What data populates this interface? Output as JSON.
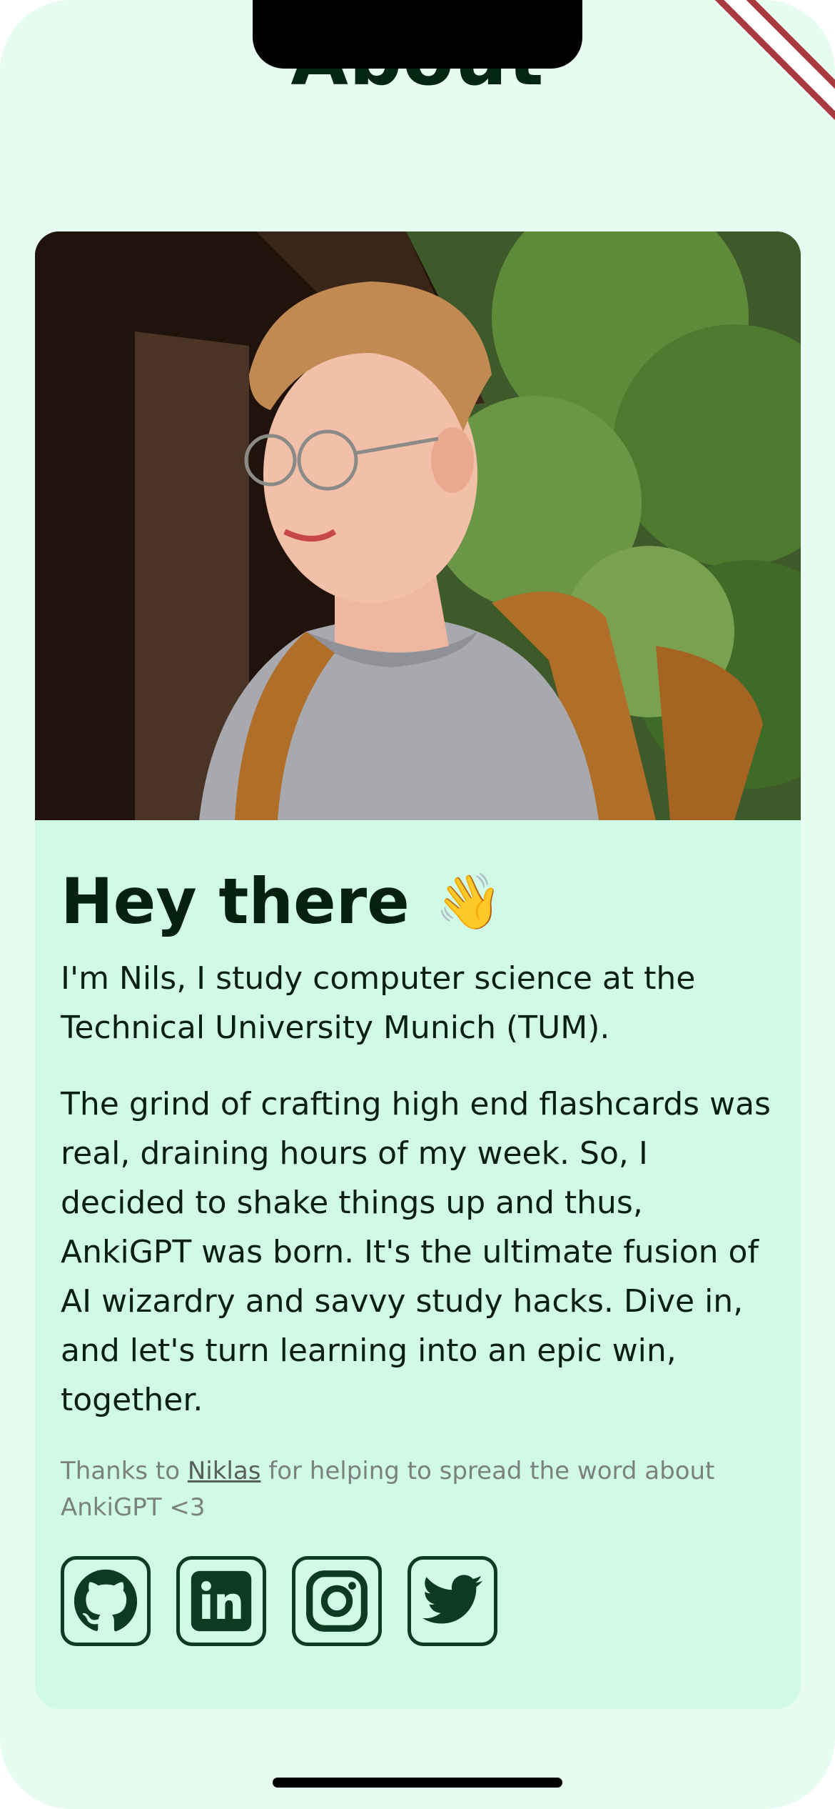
{
  "page": {
    "title": "About"
  },
  "card": {
    "heading": "Hey there",
    "wave_emoji": "👋",
    "intro": "I'm Nils, I study computer science at the Technical University Munich (TUM).",
    "story": "The grind of crafting high end flashcards was real, draining hours of my week. So, I decided to shake things up and thus, AnkiGPT was born. It's the ultimate fusion of AI wizardry and savvy study hacks. Dive in, and let's turn learning into an epic win, together.",
    "thanks_prefix": "Thanks to ",
    "thanks_link": "Niklas",
    "thanks_suffix": " for helping to spread the word about AnkiGPT <3"
  },
  "socials": [
    {
      "name": "github",
      "icon": "github-icon"
    },
    {
      "name": "linkedin",
      "icon": "linkedin-icon"
    },
    {
      "name": "instagram",
      "icon": "instagram-icon"
    },
    {
      "name": "twitter",
      "icon": "twitter-icon"
    }
  ],
  "colors": {
    "background": "#e6fcf0",
    "card": "#d0f9e6",
    "text_dark": "#06210f",
    "icon_stroke": "#0c3b22",
    "muted": "#7a8280"
  }
}
